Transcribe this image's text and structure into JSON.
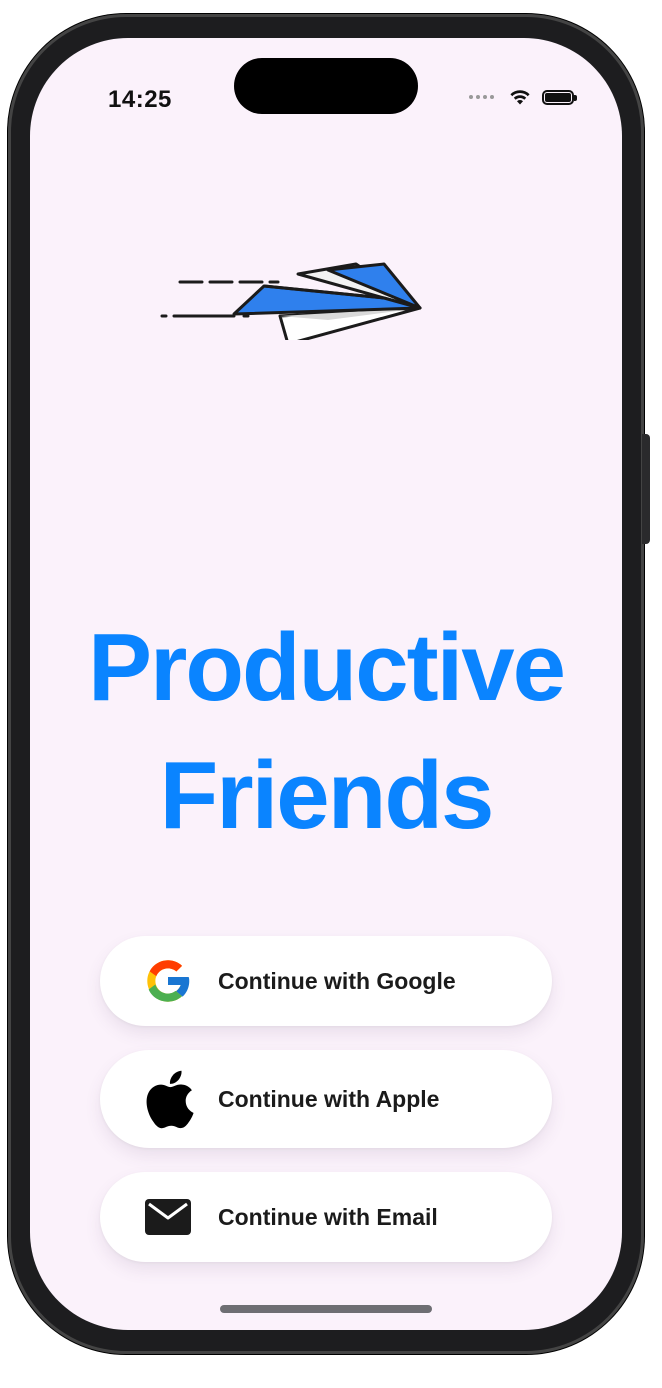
{
  "status_bar": {
    "time": "14:25",
    "icons": [
      "signal-dots-icon",
      "wifi-icon",
      "battery-icon"
    ]
  },
  "hero": {
    "illustration": "paper-plane-icon",
    "title_line1": "Productive",
    "title_line2": "Friends",
    "title_color": "#0a84ff"
  },
  "auth_buttons": [
    {
      "label": "Continue with Google",
      "icon": "google-icon"
    },
    {
      "label": "Continue with Apple",
      "icon": "apple-icon"
    },
    {
      "label": "Continue with Email",
      "icon": "mail-icon"
    }
  ],
  "colors": {
    "background": "#fbf2fb",
    "accent": "#0a84ff",
    "plane_blue": "#2f80ed",
    "button_bg": "#ffffff"
  }
}
